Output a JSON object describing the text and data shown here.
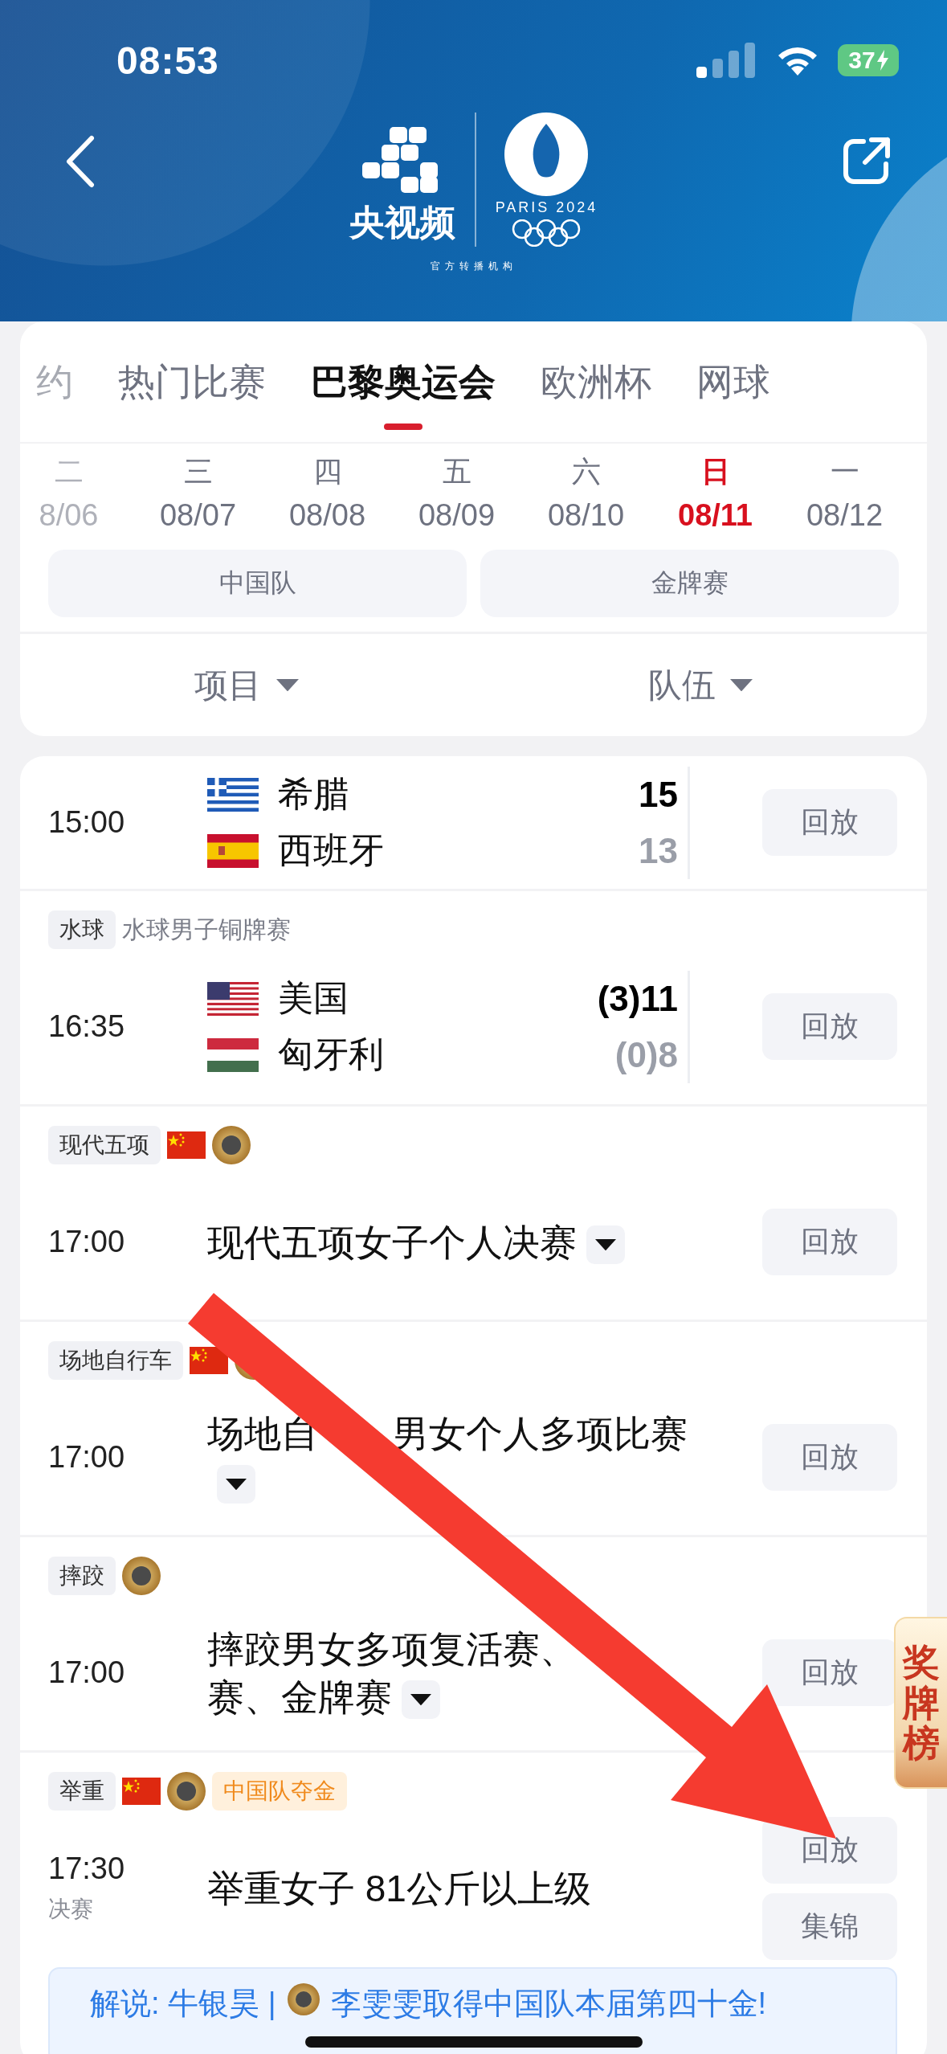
{
  "status_bar": {
    "time": "08:53",
    "battery": "37"
  },
  "header": {
    "brand": "央视频",
    "event_mark": "PARIS 2024",
    "caption": "官方转播机构"
  },
  "tabs": [
    {
      "label": "约",
      "selected": false
    },
    {
      "label": "热门比赛",
      "selected": false
    },
    {
      "label": "巴黎奥运会",
      "selected": true
    },
    {
      "label": "欧洲杯",
      "selected": false
    },
    {
      "label": "网球",
      "selected": false
    }
  ],
  "days": [
    {
      "weekday": "二",
      "date": "8/06",
      "selected": false
    },
    {
      "weekday": "三",
      "date": "08/07",
      "selected": false
    },
    {
      "weekday": "四",
      "date": "08/08",
      "selected": false
    },
    {
      "weekday": "五",
      "date": "08/09",
      "selected": false
    },
    {
      "weekday": "六",
      "date": "08/10",
      "selected": false
    },
    {
      "weekday": "日",
      "date": "08/11",
      "selected": true
    },
    {
      "weekday": "一",
      "date": "08/12",
      "selected": false
    }
  ],
  "filters": [
    "中国队",
    "金牌赛"
  ],
  "dropdowns": [
    "项目",
    "队伍"
  ],
  "matches": [
    {
      "kind": "versus",
      "time": "15:00",
      "teams": [
        {
          "name": "希腊",
          "kind": "gr",
          "score": "15",
          "leading": true
        },
        {
          "name": "西班牙",
          "kind": "es",
          "score": "13",
          "leading": false
        }
      ],
      "buttons": [
        "回放"
      ]
    },
    {
      "kind": "versus",
      "sport": "水球",
      "label": "水球男子铜牌赛",
      "time": "16:35",
      "teams": [
        {
          "name": "美国",
          "kind": "us",
          "score": "(3)11",
          "leading": true
        },
        {
          "name": "匈牙利",
          "kind": "hu",
          "score": "(0)8",
          "leading": false
        }
      ],
      "buttons": [
        "回放"
      ]
    },
    {
      "kind": "event",
      "sport": "现代五项",
      "china": true,
      "gold_medal": true,
      "time": "17:00",
      "title": [
        "现代五项女子个人决赛"
      ],
      "expandable": true,
      "buttons": [
        "回放"
      ]
    },
    {
      "kind": "event",
      "sport": "场地自行车",
      "china": true,
      "gold_medal": true,
      "time": "17:00",
      "title": [
        "场地自",
        "男女个人多项比赛"
      ],
      "expandable": true,
      "buttons": [
        "回放"
      ]
    },
    {
      "kind": "event",
      "sport": "摔跤",
      "china": false,
      "gold_medal": true,
      "time": "17:00",
      "title": [
        "摔跤男女多项复活赛、",
        "赛、金牌赛"
      ],
      "expandable": true,
      "buttons": [
        "回放"
      ]
    },
    {
      "kind": "event",
      "sport": "举重",
      "china": true,
      "gold_medal": true,
      "tag": "中国队夺金",
      "time": "17:30",
      "round": "决赛",
      "title": [
        "举重女子 81公斤以上级"
      ],
      "expandable": false,
      "buttons": [
        "回放",
        "集锦"
      ]
    }
  ],
  "ticker": {
    "commentator": "解说: 牛银昊 |",
    "headline": "李雯雯取得中国队本届第四十金!"
  },
  "side_tab": "奖牌榜"
}
